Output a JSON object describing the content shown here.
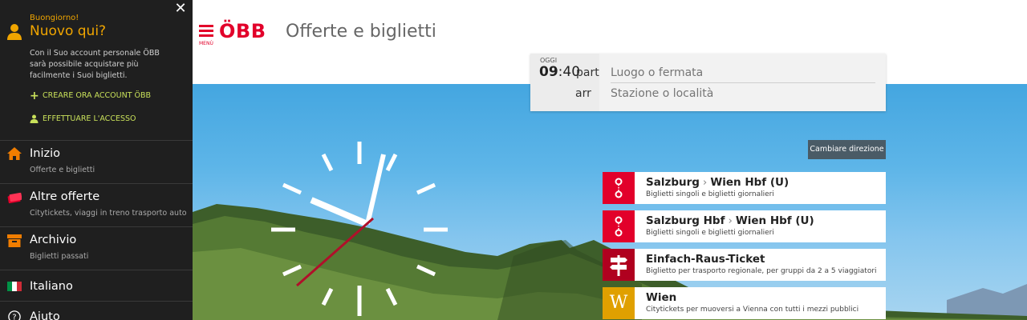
{
  "sidebar": {
    "greeting": "Buongiorno!",
    "welcome": "Nuovo qui?",
    "intro": "Con il Suo account personale ÖBB sarà possibile acquistare più facilmente i Suoi biglietti.",
    "create_account": "CREARE ORA ACCOUNT ÖBB",
    "login": "EFFETTUARE L'ACCESSO",
    "items": [
      {
        "title": "Inizio",
        "subtitle": "Offerte e biglietti",
        "icon": "home-icon"
      },
      {
        "title": "Altre offerte",
        "subtitle": "Citytickets, viaggi in treno trasporto auto, ...",
        "icon": "tickets-icon"
      },
      {
        "title": "Archivio",
        "subtitle": "Biglietti passati",
        "icon": "archive-icon"
      },
      {
        "title": "Italiano",
        "subtitle": "",
        "icon": "italy-flag-icon"
      },
      {
        "title": "Aiuto",
        "subtitle": "",
        "icon": "help-icon"
      }
    ],
    "accent": "#f0a500",
    "link_color": "#c8e05a"
  },
  "header": {
    "menu_label": "MENÙ",
    "brand": "ÖBB",
    "title": "Offerte e biglietti",
    "brand_color": "#e2002a"
  },
  "search": {
    "today_label": "OGGI",
    "time_hour": "09",
    "time_min": ":40",
    "part_label": "part",
    "arr_label": "arr",
    "from_placeholder": "Luogo o fermata",
    "to_placeholder": "Stazione o località"
  },
  "switch_direction": "Cambiare direzione",
  "tiles": [
    {
      "from": "Salzburg",
      "to": "Wien Hbf (U)",
      "subtitle": "Biglietti singoli e biglietti giornalieri",
      "icon": "route-icon",
      "color": "#e2002a"
    },
    {
      "from": "Salzburg Hbf",
      "to": "Wien Hbf (U)",
      "subtitle": "Biglietti singoli e biglietti giornalieri",
      "icon": "route-icon",
      "color": "#e2002a"
    },
    {
      "title": "Einfach-Raus-Ticket",
      "subtitle": "Biglietto per trasporto regionale, per gruppi da 2 a 5 viaggiatori",
      "icon": "signpost-icon",
      "color": "#b0001f"
    },
    {
      "title": "Wien",
      "subtitle": "Citytickets per muoversi a Vienna con tutti i mezzi pubblici",
      "icon_letter": "W",
      "icon": "city-w-icon",
      "color": "#e0a000"
    }
  ]
}
